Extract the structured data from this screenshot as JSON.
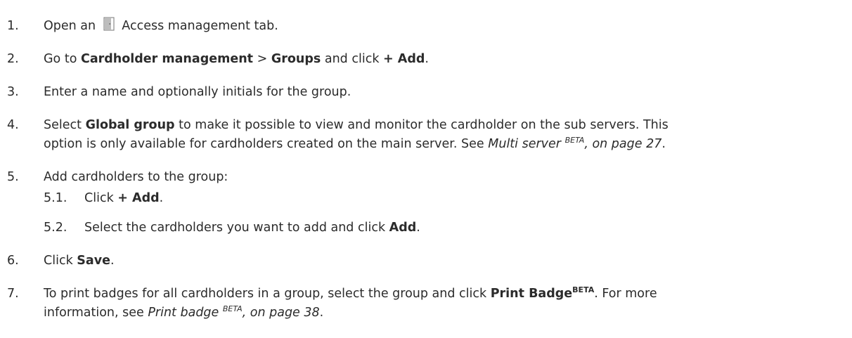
{
  "steps": [
    {
      "num": "1.",
      "open": "Open an",
      "tab": "Access management tab."
    },
    {
      "num": "2.",
      "go": "Go to",
      "cardholder_mgmt": "Cardholder management",
      "sep": ">",
      "groups": "Groups",
      "and_click": "and click",
      "add": "+ Add",
      "end": "."
    },
    {
      "num": "3.",
      "text": "Enter a name and optionally initials for the group."
    },
    {
      "num": "4.",
      "select": "Select",
      "global_group": "Global group",
      "line1_rest": "to make it possible to view and monitor the cardholder on the sub servers. This",
      "line2_start": "option is only available for cardholders created on the main server. See",
      "link_text": "Multi server",
      "link_sup": "BETA",
      "link_page": ", on page 27",
      "end": "."
    },
    {
      "num": "5.",
      "text": "Add cardholders to the group:"
    },
    {
      "num": "5.1.",
      "click": "Click",
      "add": "+ Add",
      "end": "."
    },
    {
      "num": "5.2.",
      "text": "Select the cardholders you want to add and click",
      "add": "Add",
      "end": "."
    },
    {
      "num": "6.",
      "click": "Click",
      "save": "Save",
      "end": "."
    },
    {
      "num": "7.",
      "line1_start": "To print badges for all cardholders in a group, select the group and click",
      "print_badge": "Print Badge",
      "print_sup": "BETA",
      "line1_end": ". For more",
      "line2_start": "information, see",
      "link_text": "Print badge",
      "link_sup": "BETA",
      "link_page": ", on page 38",
      "end": "."
    }
  ],
  "icons": {
    "access_management": "door-icon"
  }
}
